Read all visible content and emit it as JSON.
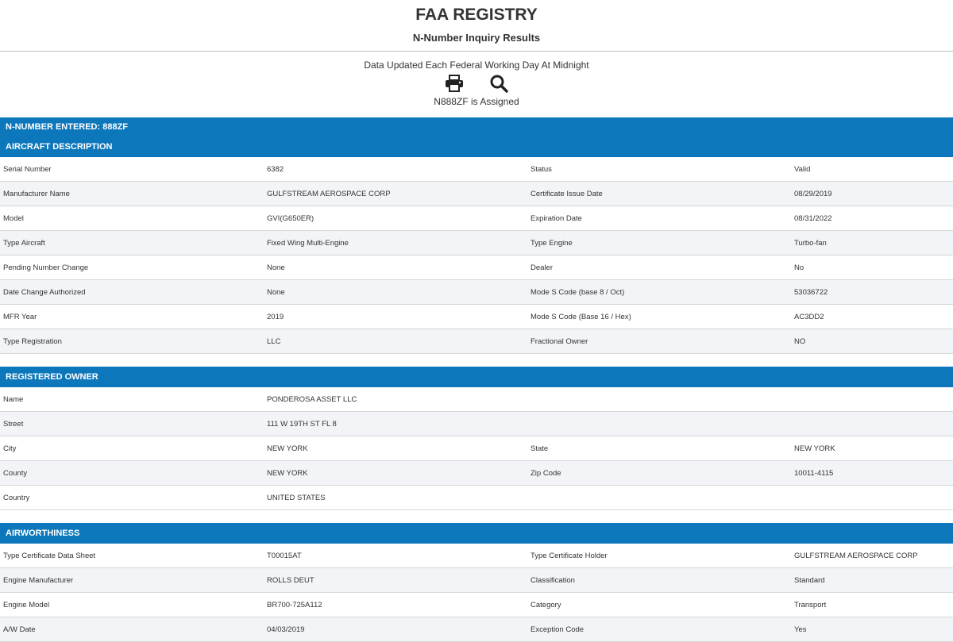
{
  "header": {
    "title": "FAA REGISTRY",
    "subtitle": "N-Number Inquiry Results"
  },
  "info": {
    "updated_text": "Data Updated Each Federal Working Day At Midnight",
    "print_icon": "print-icon",
    "search_icon": "search-icon",
    "assigned_text": "N888ZF is Assigned"
  },
  "nnumber": {
    "label": "N-NUMBER ENTERED: 888ZF"
  },
  "aircraft": {
    "title": "AIRCRAFT DESCRIPTION",
    "rows": [
      [
        "Serial Number",
        "6382",
        "Status",
        "Valid"
      ],
      [
        "Manufacturer Name",
        "GULFSTREAM AEROSPACE CORP",
        "Certificate Issue Date",
        "08/29/2019"
      ],
      [
        "Model",
        "GVI(G650ER)",
        "Expiration Date",
        "08/31/2022"
      ],
      [
        "Type Aircraft",
        "Fixed Wing Multi-Engine",
        "Type Engine",
        "Turbo-fan"
      ],
      [
        "Pending Number Change",
        "None",
        "Dealer",
        "No"
      ],
      [
        "Date Change Authorized",
        "None",
        "Mode S Code (base 8 / Oct)",
        "53036722"
      ],
      [
        "MFR Year",
        "2019",
        "Mode S Code (Base 16 / Hex)",
        "AC3DD2"
      ],
      [
        "Type Registration",
        "LLC",
        "Fractional Owner",
        "NO"
      ]
    ]
  },
  "owner": {
    "title": "REGISTERED OWNER",
    "rows": [
      [
        "Name",
        "PONDEROSA ASSET LLC",
        "",
        ""
      ],
      [
        "Street",
        "111 W 19TH ST FL 8",
        "",
        ""
      ],
      [
        "City",
        "NEW YORK",
        "State",
        "NEW YORK"
      ],
      [
        "County",
        "NEW YORK",
        "Zip Code",
        "10011-4115"
      ],
      [
        "Country",
        "UNITED STATES",
        "",
        ""
      ]
    ]
  },
  "airworthiness": {
    "title": "AIRWORTHINESS",
    "rows": [
      [
        "Type Certificate Data Sheet",
        "T00015AT",
        "Type Certificate Holder",
        "GULFSTREAM AEROSPACE CORP"
      ],
      [
        "Engine Manufacturer",
        "ROLLS DEUT",
        "Classification",
        "Standard"
      ],
      [
        "Engine Model",
        "BR700-725A112",
        "Category",
        "Transport"
      ],
      [
        "A/W Date",
        "04/03/2019",
        "Exception Code",
        "Yes"
      ]
    ]
  },
  "colors": {
    "accent": "#0d77bb",
    "row_alt": "#f2f4f7",
    "border": "#d6d6d6"
  }
}
